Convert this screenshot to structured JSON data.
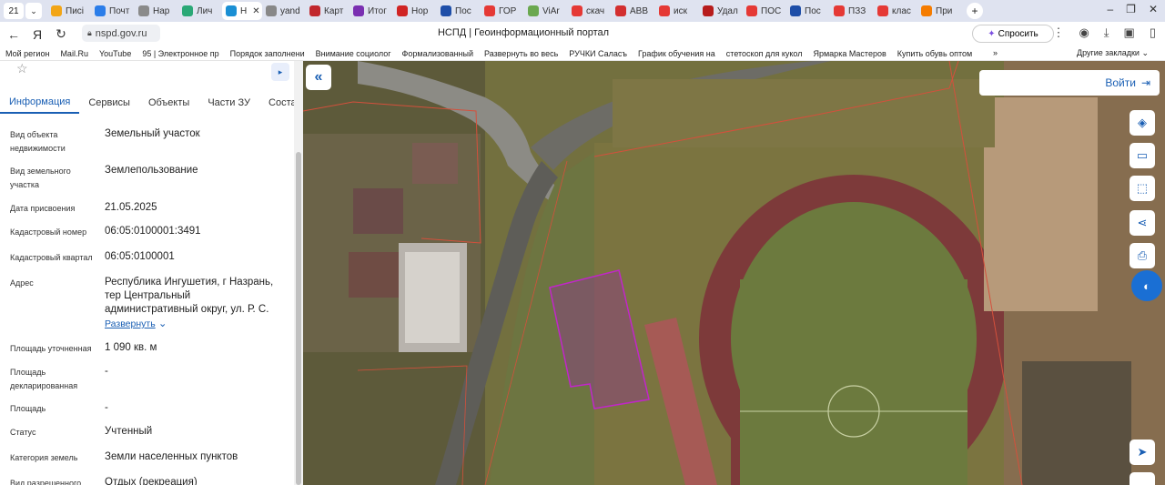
{
  "browser": {
    "tab_count": "21",
    "tabs": [
      {
        "label": "Писі",
        "color": "#f2a516"
      },
      {
        "label": "Почт",
        "color": "#2b7de9"
      },
      {
        "label": "Нар",
        "color": "#8a8a8a"
      },
      {
        "label": "Лич",
        "color": "#2aa876"
      },
      {
        "label": "Н",
        "color": "#1a8fd4",
        "active": true
      },
      {
        "label": "yand",
        "color": "#888888"
      },
      {
        "label": "Карт",
        "color": "#c1272d"
      },
      {
        "label": "Итог",
        "color": "#7a2fb1"
      },
      {
        "label": "Нор",
        "color": "#d02424"
      },
      {
        "label": "Пос",
        "color": "#1e4ea8"
      },
      {
        "label": "ГОР",
        "color": "#e53935"
      },
      {
        "label": "ViAr",
        "color": "#6aa84f"
      },
      {
        "label": "скач",
        "color": "#e53935"
      },
      {
        "label": "ABB",
        "color": "#d32f2f"
      },
      {
        "label": "иск",
        "color": "#e53935"
      },
      {
        "label": "Удал",
        "color": "#b71c1c"
      },
      {
        "label": "ПОС",
        "color": "#e53935"
      },
      {
        "label": "Пос",
        "color": "#1e4ea8"
      },
      {
        "label": "ПЗЗ",
        "color": "#e53935"
      },
      {
        "label": "клас",
        "color": "#e53935"
      },
      {
        "label": "При",
        "color": "#f57c00"
      }
    ],
    "url": "nspd.gov.ru",
    "page_title": "НСПД | Геоинформационный портал",
    "ask_button": "Спросить",
    "bookmarks": [
      "Мой регион",
      "Mail.Ru",
      "YouTube",
      "95 | Электронное пр",
      "Порядок заполнени",
      "Внимание социолог",
      "Формализованный",
      "Развернуть во весь",
      "РУЧКИ Саласъ",
      "График обучения на",
      "стетоскоп для кукол",
      "Ярмарка Мастеров",
      "Купить обувь оптом"
    ],
    "bookmarks_other": "Другие закладки"
  },
  "panel": {
    "tabs": [
      "Информация",
      "Сервисы",
      "Объекты",
      "Части ЗУ",
      "Соста"
    ],
    "attributes": [
      {
        "key": "Вид объекта недвижимости",
        "value": "Земельный участок"
      },
      {
        "key": "Вид земельного участка",
        "value": "Землепользование"
      },
      {
        "key": "Дата присвоения",
        "value": "21.05.2025"
      },
      {
        "key": "Кадастровый номер",
        "value": "06:05:0100001:3491"
      },
      {
        "key": "Кадастровый квартал",
        "value": "06:05:0100001"
      },
      {
        "key": "Адрес",
        "value": "Республика Ингушетия, г Назрань, тер Центральный административный округ, ул. Р. С."
      },
      {
        "key": "Площадь уточненная",
        "value": "1 090 кв. м"
      },
      {
        "key": "Площадь декларированная",
        "value": "-"
      },
      {
        "key": "Площадь",
        "value": "-"
      },
      {
        "key": "Статус",
        "value": "Учтенный"
      },
      {
        "key": "Категория земель",
        "value": "Земли населенных пунктов"
      },
      {
        "key": "Вид разрешенного",
        "value": "Отдых (рекреация)"
      }
    ],
    "expand_label": "Развернуть"
  },
  "map": {
    "login_label": "Войти"
  }
}
